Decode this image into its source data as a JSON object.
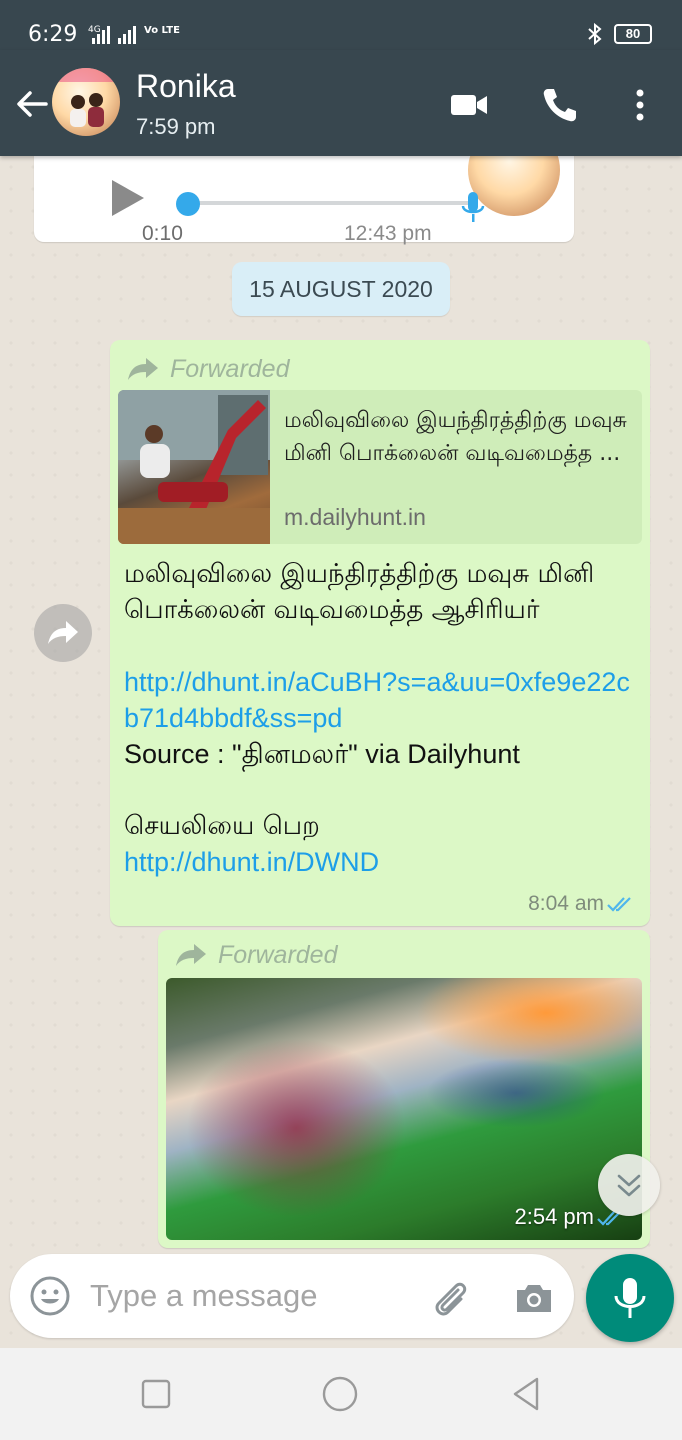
{
  "status_bar": {
    "time": "6:29",
    "network_label": "4G",
    "volte_label": "Vo LTE",
    "battery": "80"
  },
  "header": {
    "contact_name": "Ronika",
    "subtitle": "7:59 pm",
    "icons": [
      "back-arrow-icon",
      "video-call-icon",
      "phone-icon",
      "more-vert-icon"
    ]
  },
  "voice_message": {
    "duration": "0:10",
    "time": "12:43 pm",
    "progress": 0.0
  },
  "date_separator": "15 AUGUST 2020",
  "message1": {
    "forwarded_label": "Forwarded",
    "preview_title": "மலிவுவிலை இயந்திரத்திற்கு மவுசு மினி பொக்லைன் வடிவமைத்த ...",
    "preview_domain": "m.dailyhunt.in",
    "body_text": "மலிவுவிலை இயந்திரத்திற்கு மவுசு மினி பொக்லைன் வடிவமைத்த ஆசிரியர்",
    "link1": "http://dhunt.in/aCuBH?s=a&uu=0xfe9e22cb71d4bbdf&ss=pd",
    "source_text": "Source : \"தினமலர்\" via Dailyhunt",
    "app_text": "செயலியை பெற",
    "link2": "http://dhunt.in/DWND",
    "time": "8:04 am",
    "status": "read"
  },
  "message2": {
    "forwarded_label": "Forwarded",
    "time": "2:54 pm",
    "status": "read"
  },
  "composer": {
    "placeholder": "Type a message"
  },
  "colors": {
    "header_bg": "#38474f",
    "outgoing_bubble": "#dcf8c6",
    "link": "#1d9ee8",
    "mic_button": "#008b7a",
    "date_chip": "#d9eef7"
  }
}
